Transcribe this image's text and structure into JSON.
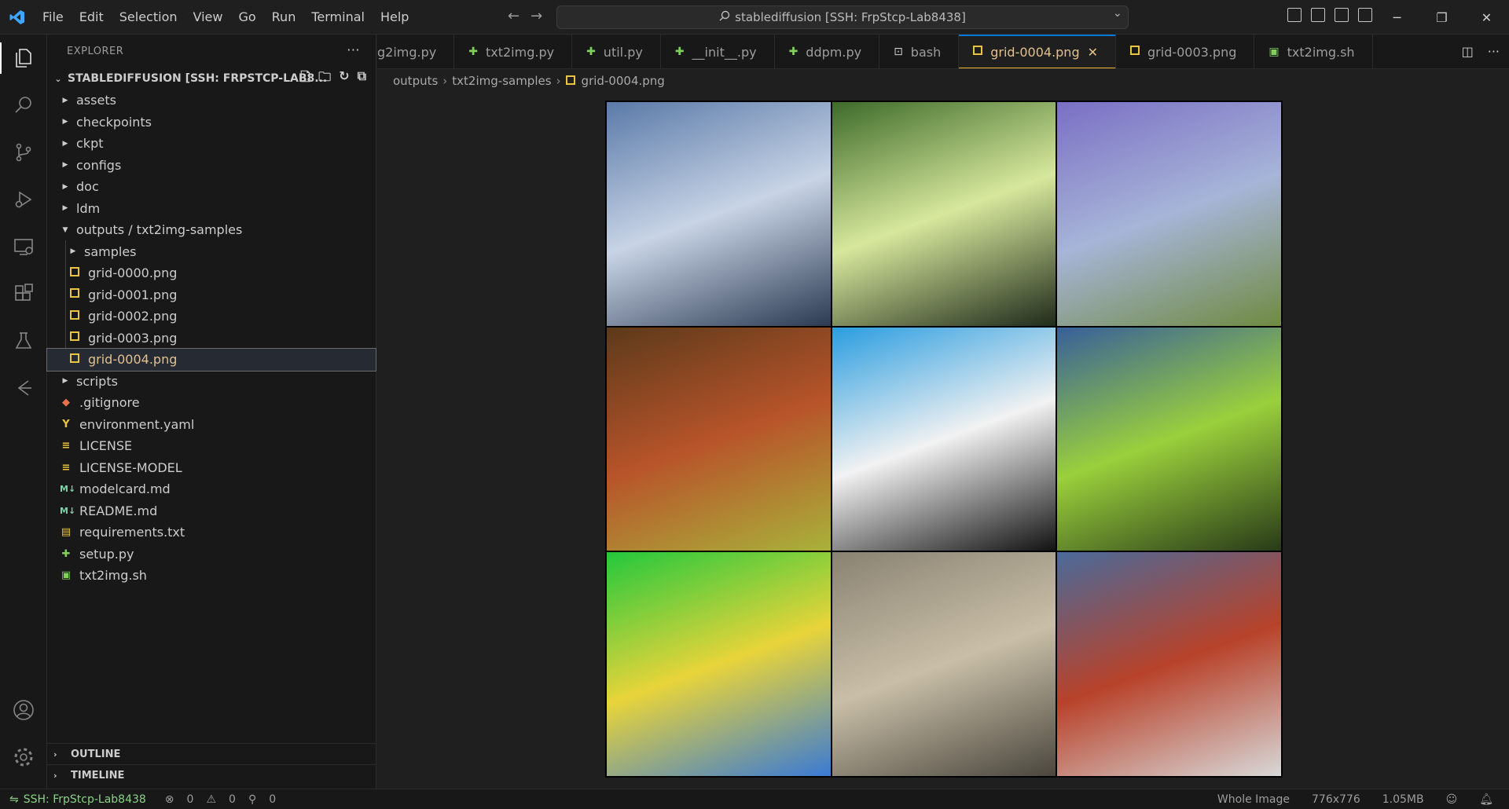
{
  "titlebar": {
    "menu": [
      "File",
      "Edit",
      "Selection",
      "View",
      "Go",
      "Run",
      "Terminal",
      "Help"
    ],
    "command_center": "stablediffusion [SSH: FrpStcp-Lab8438]"
  },
  "sidebar": {
    "header": "EXPLORER",
    "root": "STABLEDIFFUSION [SSH: FRPSTCP-LAB8...",
    "items": [
      {
        "label": "assets",
        "type": "folder"
      },
      {
        "label": "checkpoints",
        "type": "folder"
      },
      {
        "label": "ckpt",
        "type": "folder"
      },
      {
        "label": "configs",
        "type": "folder"
      },
      {
        "label": "doc",
        "type": "folder"
      },
      {
        "label": "ldm",
        "type": "folder"
      },
      {
        "label": "outputs / txt2img-samples",
        "type": "folder-open"
      },
      {
        "label": "samples",
        "type": "subfolder"
      },
      {
        "label": "grid-0000.png",
        "type": "image"
      },
      {
        "label": "grid-0001.png",
        "type": "image"
      },
      {
        "label": "grid-0002.png",
        "type": "image"
      },
      {
        "label": "grid-0003.png",
        "type": "image"
      },
      {
        "label": "grid-0004.png",
        "type": "image"
      },
      {
        "label": "scripts",
        "type": "folder"
      },
      {
        "label": ".gitignore",
        "type": "git"
      },
      {
        "label": "environment.yaml",
        "type": "yaml"
      },
      {
        "label": "LICENSE",
        "type": "text"
      },
      {
        "label": "LICENSE-MODEL",
        "type": "text"
      },
      {
        "label": "modelcard.md",
        "type": "md"
      },
      {
        "label": "README.md",
        "type": "md"
      },
      {
        "label": "requirements.txt",
        "type": "req"
      },
      {
        "label": "setup.py",
        "type": "py"
      },
      {
        "label": "txt2img.sh",
        "type": "sh"
      }
    ],
    "outline": "OUTLINE",
    "timeline": "TIMELINE"
  },
  "tabs": [
    {
      "label": "g2img.py",
      "icon": "python-icon"
    },
    {
      "label": "txt2img.py",
      "icon": "python-icon"
    },
    {
      "label": "util.py",
      "icon": "python-icon"
    },
    {
      "label": "__init__.py",
      "icon": "python-icon"
    },
    {
      "label": "ddpm.py",
      "icon": "python-icon"
    },
    {
      "label": "bash",
      "icon": "terminal-icon"
    },
    {
      "label": "grid-0004.png",
      "icon": "image-icon"
    },
    {
      "label": "grid-0003.png",
      "icon": "image-icon"
    },
    {
      "label": "txt2img.sh",
      "icon": "shell-icon"
    }
  ],
  "breadcrumb": {
    "part1": "outputs",
    "part2": "txt2img-samples",
    "part3": "grid-0004.png"
  },
  "image_grid": {
    "colors": [
      [
        "#5a7aa8",
        "#c8d4e6",
        "#2b3a52"
      ],
      [
        "#3d6b2a",
        "#d7e89c",
        "#1f2a1a"
      ],
      [
        "#7a6fc4",
        "#a7b5d8",
        "#6f8a42"
      ],
      [
        "#5c3a1a",
        "#b8542a",
        "#a9b23a"
      ],
      [
        "#2a9de0",
        "#f2f2f2",
        "#121212"
      ],
      [
        "#375f9a",
        "#9ad03c",
        "#283a18"
      ],
      [
        "#23c83d",
        "#e8d43a",
        "#3a7ad4"
      ],
      [
        "#8a8272",
        "#c9bfa8",
        "#4a463d"
      ],
      [
        "#4a6a9a",
        "#b8422a",
        "#d8d8d8"
      ]
    ]
  },
  "statusbar": {
    "remote": "SSH: FrpStcp-Lab8438",
    "errors": "0",
    "warnings": "0",
    "ports": "0",
    "zoom_mode": "Whole Image",
    "dimensions": "776x776",
    "file_size": "1.05MB"
  }
}
